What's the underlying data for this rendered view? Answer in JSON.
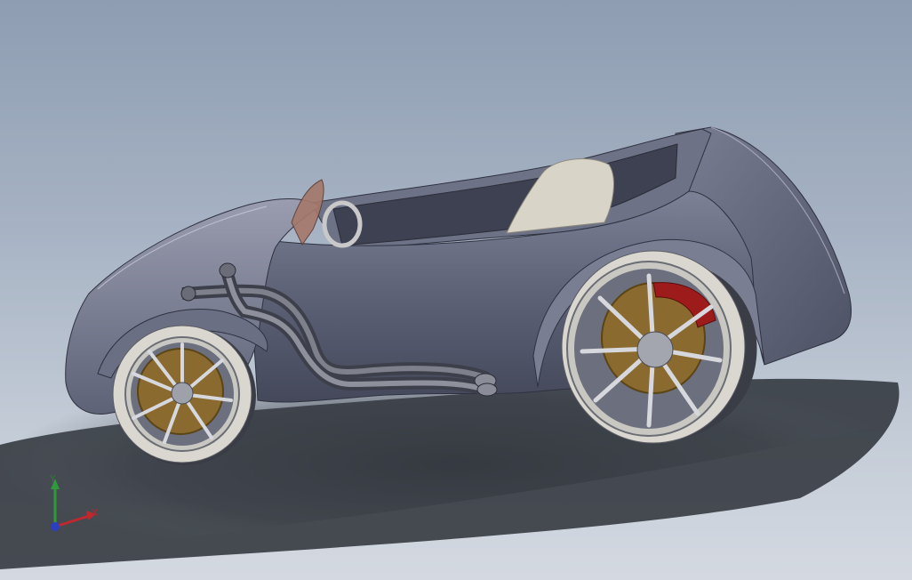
{
  "viewport": {
    "background_top": "#8e9db2",
    "background_bottom": "#d4d9e1"
  },
  "model": {
    "body_color": "#5b5f73",
    "tire_color": "#d9d7cf",
    "rotor_color": "#8a6a2f",
    "caliper_color": "#9e1b1b",
    "seat_color": "#d8d4c8"
  },
  "triad": {
    "x_label": "X",
    "y_label": "Y",
    "x_color": "#c0282d",
    "y_color": "#2e9a3a",
    "z_color": "#2b3fbf"
  }
}
